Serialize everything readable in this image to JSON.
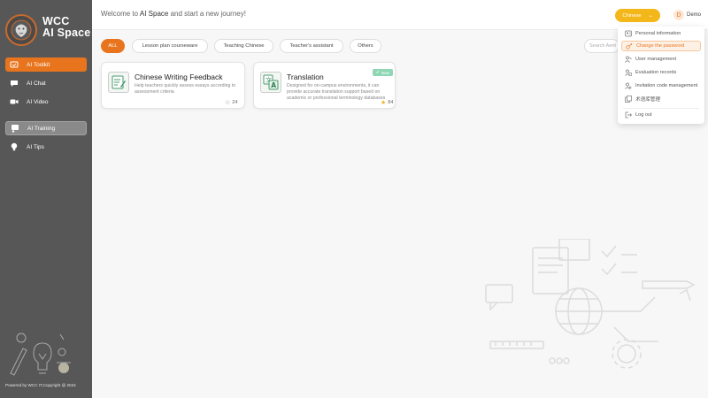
{
  "brand": {
    "line1": "WCC",
    "line2": "AI Space"
  },
  "sidebar": {
    "items": [
      {
        "label": "AI Toolkit",
        "icon": "toolkit-icon",
        "state": "active"
      },
      {
        "label": "AI Chat",
        "icon": "chat-icon",
        "state": "normal"
      },
      {
        "label": "AI Video",
        "icon": "video-icon",
        "state": "normal"
      },
      {
        "label": "AI Training",
        "icon": "training-icon",
        "state": "selected"
      },
      {
        "label": "AI Tips",
        "icon": "lightbulb-icon",
        "state": "normal"
      }
    ],
    "copyright": "Powered by WCC IT,Copyright @ 2024"
  },
  "header": {
    "welcome_prefix": "Welcome to",
    "welcome_highlight": "AI Space",
    "welcome_suffix": "and start a new journey!",
    "language": "Chinese",
    "user_initial": "D",
    "user_name": "Demo"
  },
  "filters": {
    "chips": [
      "ALL",
      "Lesson plan courseware",
      "Teaching Chinese",
      "Teacher's assistant",
      "Others"
    ],
    "active": "ALL",
    "search_placeholder": "Search Aent"
  },
  "cards": [
    {
      "title": "Chinese Writing Feedback",
      "description": "Help teachers quickly assess essays according to assessment criteria",
      "favorites": "24",
      "favorited": false,
      "badge": ""
    },
    {
      "title": "Translation",
      "description": "Designed for on-campus environments, it can provide accurate translation support based on academic or professional terminology databases",
      "favorites": "84",
      "favorited": true,
      "badge": "New"
    }
  ],
  "user_menu": {
    "items": [
      {
        "label": "Personal information",
        "icon": "user-card-icon"
      },
      {
        "label": "Change the password",
        "icon": "key-icon",
        "highlighted": true
      },
      {
        "label": "User management",
        "icon": "users-icon"
      },
      {
        "label": "Evaluation records",
        "icon": "records-icon"
      },
      {
        "label": "Invitation code management",
        "icon": "invite-icon"
      },
      {
        "label": "术语库管理",
        "icon": "glossary-icon"
      }
    ],
    "logout": "Log out"
  },
  "colors": {
    "accent": "#e8751d",
    "sidebar": "#575757",
    "language_button": "#f4b719",
    "new_badge": "#8fd6b4"
  }
}
